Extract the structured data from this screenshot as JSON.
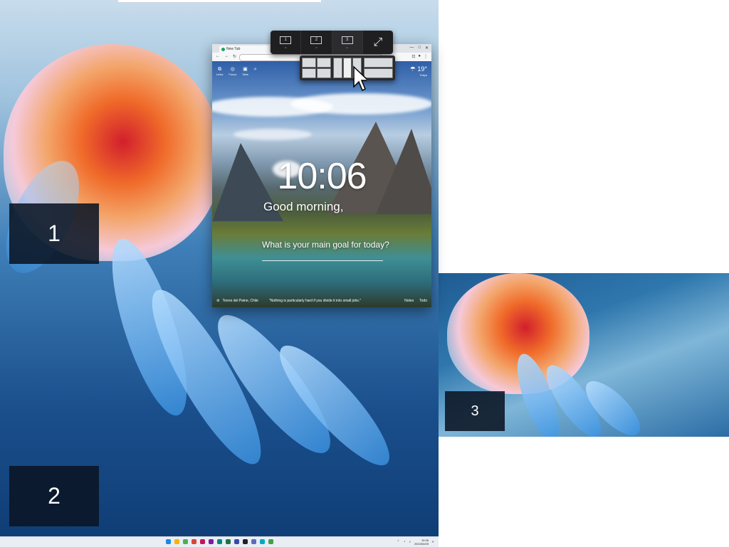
{
  "monitors": {
    "labels": [
      "1",
      "2",
      "3"
    ]
  },
  "browser": {
    "tab_title": "New Tab",
    "window_controls": [
      "—",
      "□",
      "✕"
    ],
    "page": {
      "shortcuts": [
        {
          "label": "Links",
          "icon": "link-icon",
          "glyph": "⧉"
        },
        {
          "label": "Focus",
          "icon": "focus-icon",
          "glyph": "◎"
        },
        {
          "label": "Tabs",
          "icon": "tabs-icon",
          "glyph": "▣"
        }
      ],
      "weather": {
        "temp": "19°",
        "city": "Tokyo",
        "icon": "cloud-rain-icon"
      },
      "clock": "10:06",
      "greeting": "Good morning,",
      "focus_question": "What is your main goal for today?",
      "location": "Torres del Paine, Chile",
      "quote": "\"Nothing is particularly hard if you divide it into small jobs.\"",
      "bottom_links": [
        "Notes",
        "Todo"
      ]
    }
  },
  "snap": {
    "monitor_buttons": [
      {
        "label": "1",
        "sub": "⊞"
      },
      {
        "label": "2",
        "sub": "⊞"
      },
      {
        "label": "3",
        "sub": "⊞"
      }
    ],
    "active_monitor": "3"
  },
  "taskbar": {
    "time": "10:06",
    "date": "2024/04/09",
    "app_colors": [
      "#1e88e5",
      "#f4b400",
      "#4caf50",
      "#db4437",
      "#c2185b",
      "#7b1fa2",
      "#00897b",
      "#217346",
      "#3949ab",
      "#222222",
      "#5c6bc0",
      "#00acc1",
      "#43a047"
    ]
  }
}
